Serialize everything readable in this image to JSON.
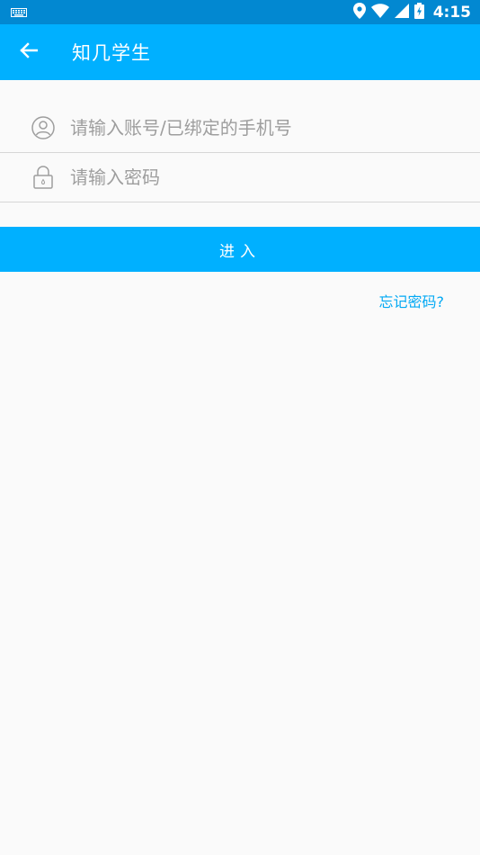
{
  "status_bar": {
    "time": "4:15",
    "icons": [
      "keyboard-icon",
      "location-icon",
      "wifi-icon",
      "signal-icon",
      "battery-charging-icon"
    ],
    "color": "#0288d1"
  },
  "app_bar": {
    "title": "知几学生",
    "back_icon": "arrow-left-icon",
    "color": "#00b0ff"
  },
  "login_form": {
    "account": {
      "placeholder": "请输入账号/已绑定的手机号",
      "value": "",
      "icon": "user-circle-icon"
    },
    "password": {
      "placeholder": "请输入密码",
      "value": "",
      "icon": "lock-icon"
    },
    "submit_label": "进入",
    "forgot_label": "忘记密码?",
    "accent_color": "#03a9f4"
  }
}
